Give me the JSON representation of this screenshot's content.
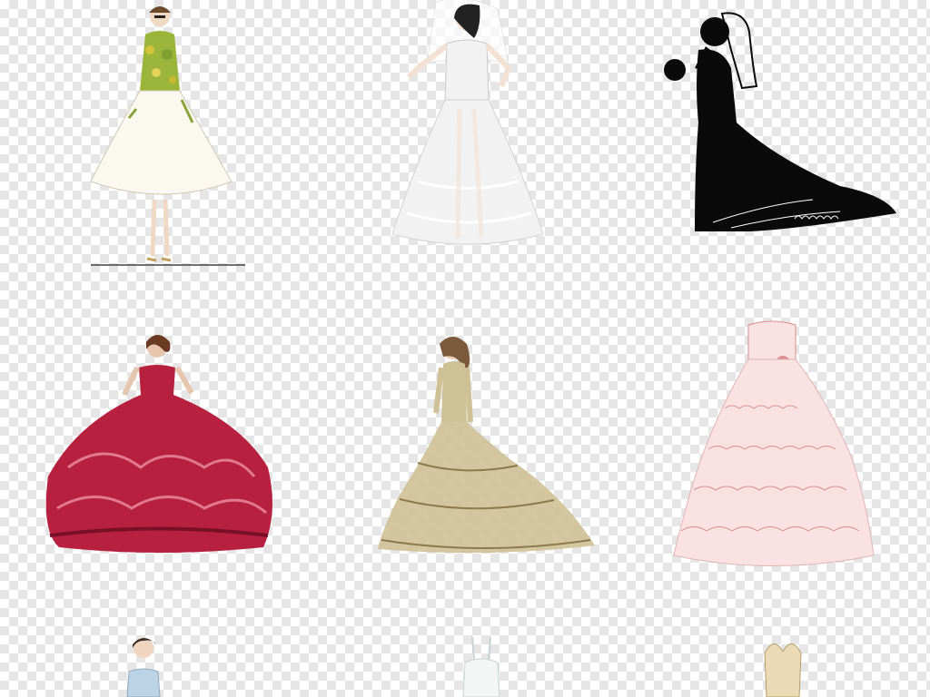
{
  "background": {
    "pattern": "transparency-checkerboard",
    "colors": [
      "#ffffff",
      "#e6e6e6"
    ]
  },
  "illustrations": [
    {
      "icon": "floral-tea-length-dress-sketch",
      "dress_color": "#fbf8ef",
      "accent_color": "#9bb53a"
    },
    {
      "icon": "white-lace-ballgown-veil-sketch",
      "dress_color": "#f2f2f2",
      "accent_color": "#222222"
    },
    {
      "icon": "black-bride-silhouette",
      "dress_color": "#0a0a0a",
      "accent_color": "#ffffff"
    },
    {
      "icon": "red-ruffled-ballgown-sketch",
      "dress_color": "#b8203f",
      "accent_color": "#e07a8c"
    },
    {
      "icon": "gold-tiered-ballgown-sketch",
      "dress_color": "#cfc196",
      "accent_color": "#8a7a4e"
    },
    {
      "icon": "pink-ruffle-strapless-gown-sketch",
      "dress_color": "#fbe2e2",
      "accent_color": "#d98e8e"
    },
    {
      "icon": "blue-bodice-bride-sketch-partial",
      "dress_color": "#bcd3e6",
      "accent_color": "#3a2a22"
    },
    {
      "icon": "white-lace-bodice-sketch-partial",
      "dress_color": "#f4f6f6",
      "accent_color": "#c9d2d3"
    },
    {
      "icon": "cream-bodice-sketch-partial",
      "dress_color": "#eadbb6",
      "accent_color": "#b79f6a"
    }
  ]
}
